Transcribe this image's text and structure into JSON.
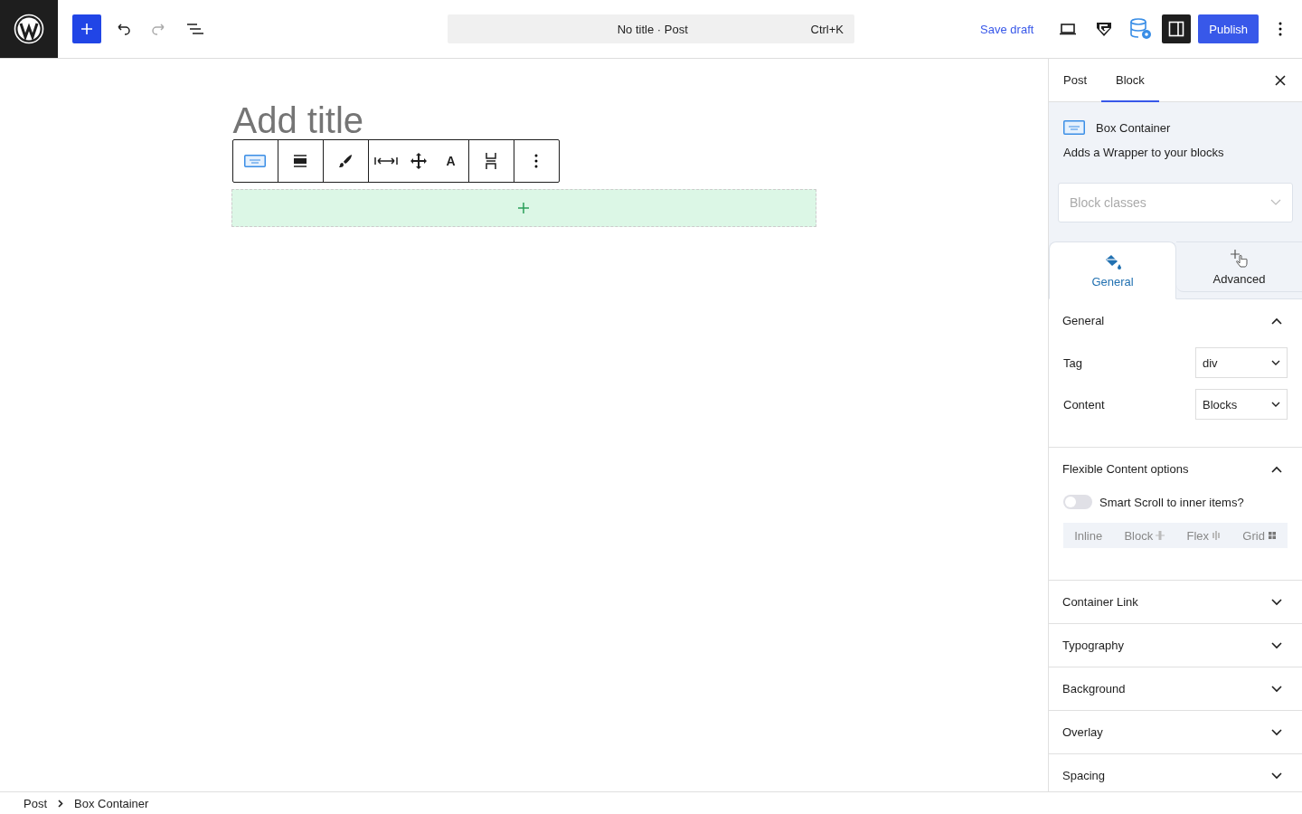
{
  "topbar": {
    "redo_disabled": true,
    "command": {
      "title": "No title · Post",
      "shortcut": "Ctrl+K"
    },
    "save_draft": "Save draft",
    "settings_on": true,
    "publish": "Publish"
  },
  "editor": {
    "title_placeholder": "Add title",
    "toolbar_letter": "A"
  },
  "sidebar": {
    "tabs": [
      {
        "label": "Post",
        "selected": false
      },
      {
        "label": "Block",
        "selected": true
      }
    ],
    "block": {
      "name": "Box Container",
      "description": "Adds a Wrapper to your blocks"
    },
    "classes_placeholder": "Block classes",
    "mode_tabs": [
      {
        "label": "General",
        "selected": true,
        "kind": "general"
      },
      {
        "label": "Advanced",
        "selected": false,
        "kind": "advanced"
      }
    ],
    "panels": [
      {
        "title": "General",
        "expanded": true,
        "kind": "fields",
        "fields": [
          {
            "label": "Tag",
            "value": "div"
          },
          {
            "label": "Content",
            "value": "Blocks"
          }
        ]
      },
      {
        "title": "Flexible Content options",
        "expanded": true,
        "kind": "flex",
        "toggle": {
          "label": "Smart Scroll to inner items?",
          "on": false
        },
        "options": [
          {
            "label": "Inline",
            "kind": "inline"
          },
          {
            "label": "Block",
            "kind": "block"
          },
          {
            "label": "Flex",
            "kind": "flex"
          },
          {
            "label": "Grid",
            "kind": "grid"
          }
        ]
      },
      {
        "title": "Container Link",
        "expanded": false
      },
      {
        "title": "Typography",
        "expanded": false
      },
      {
        "title": "Background",
        "expanded": false
      },
      {
        "title": "Overlay",
        "expanded": false
      },
      {
        "title": "Spacing",
        "expanded": false
      }
    ]
  },
  "breadcrumb": [
    "Post",
    "Box Container"
  ]
}
